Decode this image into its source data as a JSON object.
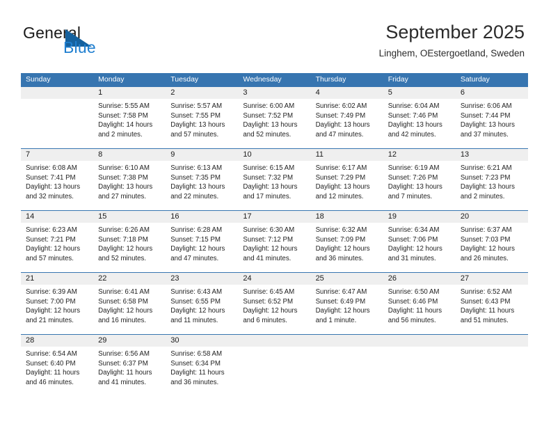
{
  "brand": {
    "name_part1": "General",
    "name_part2": "Blue",
    "triangle_color": "#15619e",
    "blue_color": "#1f7fd0"
  },
  "header": {
    "title": "September 2025",
    "location": "Linghem, OEstergoetland, Sweden"
  },
  "theme": {
    "header_blue": "#3775b0",
    "day_band_gray": "#efefef",
    "text_color": "#1f1f1f"
  },
  "weekdays": [
    "Sunday",
    "Monday",
    "Tuesday",
    "Wednesday",
    "Thursday",
    "Friday",
    "Saturday"
  ],
  "labels": {
    "sunrise_prefix": "Sunrise:",
    "sunset_prefix": "Sunset:",
    "daylight_prefix": "Daylight:"
  },
  "weeks": [
    {
      "days": [
        {
          "number": "",
          "sunrise": "",
          "sunset": "",
          "daylight_line1": "",
          "daylight_line2": "",
          "empty": true
        },
        {
          "number": "1",
          "sunrise": "Sunrise: 5:55 AM",
          "sunset": "Sunset: 7:58 PM",
          "daylight_line1": "Daylight: 14 hours",
          "daylight_line2": "and 2 minutes.",
          "empty": false
        },
        {
          "number": "2",
          "sunrise": "Sunrise: 5:57 AM",
          "sunset": "Sunset: 7:55 PM",
          "daylight_line1": "Daylight: 13 hours",
          "daylight_line2": "and 57 minutes.",
          "empty": false
        },
        {
          "number": "3",
          "sunrise": "Sunrise: 6:00 AM",
          "sunset": "Sunset: 7:52 PM",
          "daylight_line1": "Daylight: 13 hours",
          "daylight_line2": "and 52 minutes.",
          "empty": false
        },
        {
          "number": "4",
          "sunrise": "Sunrise: 6:02 AM",
          "sunset": "Sunset: 7:49 PM",
          "daylight_line1": "Daylight: 13 hours",
          "daylight_line2": "and 47 minutes.",
          "empty": false
        },
        {
          "number": "5",
          "sunrise": "Sunrise: 6:04 AM",
          "sunset": "Sunset: 7:46 PM",
          "daylight_line1": "Daylight: 13 hours",
          "daylight_line2": "and 42 minutes.",
          "empty": false
        },
        {
          "number": "6",
          "sunrise": "Sunrise: 6:06 AM",
          "sunset": "Sunset: 7:44 PM",
          "daylight_line1": "Daylight: 13 hours",
          "daylight_line2": "and 37 minutes.",
          "empty": false
        }
      ]
    },
    {
      "days": [
        {
          "number": "7",
          "sunrise": "Sunrise: 6:08 AM",
          "sunset": "Sunset: 7:41 PM",
          "daylight_line1": "Daylight: 13 hours",
          "daylight_line2": "and 32 minutes.",
          "empty": false
        },
        {
          "number": "8",
          "sunrise": "Sunrise: 6:10 AM",
          "sunset": "Sunset: 7:38 PM",
          "daylight_line1": "Daylight: 13 hours",
          "daylight_line2": "and 27 minutes.",
          "empty": false
        },
        {
          "number": "9",
          "sunrise": "Sunrise: 6:13 AM",
          "sunset": "Sunset: 7:35 PM",
          "daylight_line1": "Daylight: 13 hours",
          "daylight_line2": "and 22 minutes.",
          "empty": false
        },
        {
          "number": "10",
          "sunrise": "Sunrise: 6:15 AM",
          "sunset": "Sunset: 7:32 PM",
          "daylight_line1": "Daylight: 13 hours",
          "daylight_line2": "and 17 minutes.",
          "empty": false
        },
        {
          "number": "11",
          "sunrise": "Sunrise: 6:17 AM",
          "sunset": "Sunset: 7:29 PM",
          "daylight_line1": "Daylight: 13 hours",
          "daylight_line2": "and 12 minutes.",
          "empty": false
        },
        {
          "number": "12",
          "sunrise": "Sunrise: 6:19 AM",
          "sunset": "Sunset: 7:26 PM",
          "daylight_line1": "Daylight: 13 hours",
          "daylight_line2": "and 7 minutes.",
          "empty": false
        },
        {
          "number": "13",
          "sunrise": "Sunrise: 6:21 AM",
          "sunset": "Sunset: 7:23 PM",
          "daylight_line1": "Daylight: 13 hours",
          "daylight_line2": "and 2 minutes.",
          "empty": false
        }
      ]
    },
    {
      "days": [
        {
          "number": "14",
          "sunrise": "Sunrise: 6:23 AM",
          "sunset": "Sunset: 7:21 PM",
          "daylight_line1": "Daylight: 12 hours",
          "daylight_line2": "and 57 minutes.",
          "empty": false
        },
        {
          "number": "15",
          "sunrise": "Sunrise: 6:26 AM",
          "sunset": "Sunset: 7:18 PM",
          "daylight_line1": "Daylight: 12 hours",
          "daylight_line2": "and 52 minutes.",
          "empty": false
        },
        {
          "number": "16",
          "sunrise": "Sunrise: 6:28 AM",
          "sunset": "Sunset: 7:15 PM",
          "daylight_line1": "Daylight: 12 hours",
          "daylight_line2": "and 47 minutes.",
          "empty": false
        },
        {
          "number": "17",
          "sunrise": "Sunrise: 6:30 AM",
          "sunset": "Sunset: 7:12 PM",
          "daylight_line1": "Daylight: 12 hours",
          "daylight_line2": "and 41 minutes.",
          "empty": false
        },
        {
          "number": "18",
          "sunrise": "Sunrise: 6:32 AM",
          "sunset": "Sunset: 7:09 PM",
          "daylight_line1": "Daylight: 12 hours",
          "daylight_line2": "and 36 minutes.",
          "empty": false
        },
        {
          "number": "19",
          "sunrise": "Sunrise: 6:34 AM",
          "sunset": "Sunset: 7:06 PM",
          "daylight_line1": "Daylight: 12 hours",
          "daylight_line2": "and 31 minutes.",
          "empty": false
        },
        {
          "number": "20",
          "sunrise": "Sunrise: 6:37 AM",
          "sunset": "Sunset: 7:03 PM",
          "daylight_line1": "Daylight: 12 hours",
          "daylight_line2": "and 26 minutes.",
          "empty": false
        }
      ]
    },
    {
      "days": [
        {
          "number": "21",
          "sunrise": "Sunrise: 6:39 AM",
          "sunset": "Sunset: 7:00 PM",
          "daylight_line1": "Daylight: 12 hours",
          "daylight_line2": "and 21 minutes.",
          "empty": false
        },
        {
          "number": "22",
          "sunrise": "Sunrise: 6:41 AM",
          "sunset": "Sunset: 6:58 PM",
          "daylight_line1": "Daylight: 12 hours",
          "daylight_line2": "and 16 minutes.",
          "empty": false
        },
        {
          "number": "23",
          "sunrise": "Sunrise: 6:43 AM",
          "sunset": "Sunset: 6:55 PM",
          "daylight_line1": "Daylight: 12 hours",
          "daylight_line2": "and 11 minutes.",
          "empty": false
        },
        {
          "number": "24",
          "sunrise": "Sunrise: 6:45 AM",
          "sunset": "Sunset: 6:52 PM",
          "daylight_line1": "Daylight: 12 hours",
          "daylight_line2": "and 6 minutes.",
          "empty": false
        },
        {
          "number": "25",
          "sunrise": "Sunrise: 6:47 AM",
          "sunset": "Sunset: 6:49 PM",
          "daylight_line1": "Daylight: 12 hours",
          "daylight_line2": "and 1 minute.",
          "empty": false
        },
        {
          "number": "26",
          "sunrise": "Sunrise: 6:50 AM",
          "sunset": "Sunset: 6:46 PM",
          "daylight_line1": "Daylight: 11 hours",
          "daylight_line2": "and 56 minutes.",
          "empty": false
        },
        {
          "number": "27",
          "sunrise": "Sunrise: 6:52 AM",
          "sunset": "Sunset: 6:43 PM",
          "daylight_line1": "Daylight: 11 hours",
          "daylight_line2": "and 51 minutes.",
          "empty": false
        }
      ]
    },
    {
      "days": [
        {
          "number": "28",
          "sunrise": "Sunrise: 6:54 AM",
          "sunset": "Sunset: 6:40 PM",
          "daylight_line1": "Daylight: 11 hours",
          "daylight_line2": "and 46 minutes.",
          "empty": false
        },
        {
          "number": "29",
          "sunrise": "Sunrise: 6:56 AM",
          "sunset": "Sunset: 6:37 PM",
          "daylight_line1": "Daylight: 11 hours",
          "daylight_line2": "and 41 minutes.",
          "empty": false
        },
        {
          "number": "30",
          "sunrise": "Sunrise: 6:58 AM",
          "sunset": "Sunset: 6:34 PM",
          "daylight_line1": "Daylight: 11 hours",
          "daylight_line2": "and 36 minutes.",
          "empty": false
        },
        {
          "number": "",
          "sunrise": "",
          "sunset": "",
          "daylight_line1": "",
          "daylight_line2": "",
          "empty": true
        },
        {
          "number": "",
          "sunrise": "",
          "sunset": "",
          "daylight_line1": "",
          "daylight_line2": "",
          "empty": true
        },
        {
          "number": "",
          "sunrise": "",
          "sunset": "",
          "daylight_line1": "",
          "daylight_line2": "",
          "empty": true
        },
        {
          "number": "",
          "sunrise": "",
          "sunset": "",
          "daylight_line1": "",
          "daylight_line2": "",
          "empty": true
        }
      ]
    }
  ]
}
